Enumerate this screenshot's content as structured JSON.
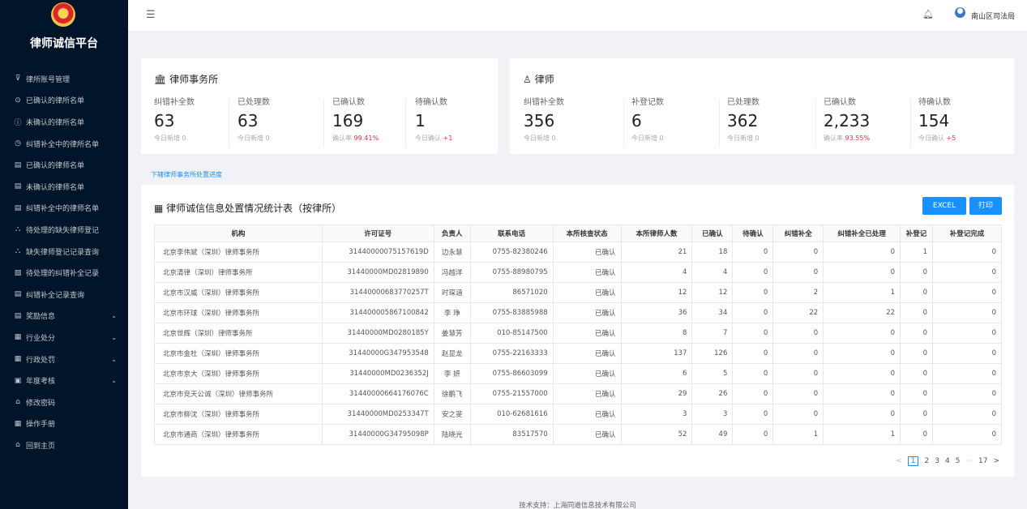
{
  "sidebar": {
    "title": "律师诚信平台",
    "items": [
      {
        "icon": "⊽",
        "label": "律所账号管理",
        "arrow": ""
      },
      {
        "icon": "⊙",
        "label": "已确认的律所名单",
        "arrow": ""
      },
      {
        "icon": "ⓘ",
        "label": "未确认的律所名单",
        "arrow": ""
      },
      {
        "icon": "◷",
        "label": "纠错补全中的律所名单",
        "arrow": ""
      },
      {
        "icon": "▤",
        "label": "已确认的律师名单",
        "arrow": ""
      },
      {
        "icon": "▤",
        "label": "未确认的律师名单",
        "arrow": ""
      },
      {
        "icon": "▤",
        "label": "纠错补全中的律师名单",
        "arrow": ""
      },
      {
        "icon": "⛬",
        "label": "待处理的缺失律师登记",
        "arrow": ""
      },
      {
        "icon": "⛬",
        "label": "缺失律师登记记录查询",
        "arrow": ""
      },
      {
        "icon": "▧",
        "label": "待处理的纠错补全记录",
        "arrow": ""
      },
      {
        "icon": "▤",
        "label": "纠错补全记录查询",
        "arrow": ""
      },
      {
        "icon": "▤",
        "label": "奖励信息",
        "arrow": "⌄"
      },
      {
        "icon": "▦",
        "label": "行业处分",
        "arrow": "⌄"
      },
      {
        "icon": "▦",
        "label": "行政处罚",
        "arrow": "⌄"
      },
      {
        "icon": "▣",
        "label": "年度考核",
        "arrow": "⌄"
      },
      {
        "icon": "⌂",
        "label": "修改密码",
        "arrow": ""
      },
      {
        "icon": "▦",
        "label": "操作手册",
        "arrow": ""
      },
      {
        "icon": "⌂",
        "label": "回到主页",
        "arrow": ""
      }
    ]
  },
  "header": {
    "user": "南山区司法局"
  },
  "firm_card": {
    "title": "律师事务所",
    "stats": [
      {
        "label": "纠错补全数",
        "value": "63",
        "sub": "今日新增 0",
        "sub_hl": ""
      },
      {
        "label": "已处理数",
        "value": "63",
        "sub": "今日新增 0",
        "sub_hl": ""
      },
      {
        "label": "已确认数",
        "value": "169",
        "sub": "确认率 ",
        "sub_hl": "99.41%"
      },
      {
        "label": "待确认数",
        "value": "1",
        "sub": "今日确认 ",
        "sub_hl": "+1"
      }
    ]
  },
  "lawyer_card": {
    "title": "律师",
    "stats": [
      {
        "label": "纠错补全数",
        "value": "356",
        "sub": "今日新增 0",
        "sub_hl": ""
      },
      {
        "label": "补登记数",
        "value": "6",
        "sub": "今日新增 0",
        "sub_hl": ""
      },
      {
        "label": "已处理数",
        "value": "362",
        "sub": "今日新增 0",
        "sub_hl": ""
      },
      {
        "label": "已确认数",
        "value": "2,233",
        "sub": "确认率 ",
        "sub_hl": "93.55%"
      },
      {
        "label": "待确认数",
        "value": "154",
        "sub": "今日确认 ",
        "sub_hl": "+5"
      }
    ]
  },
  "progress_link": "下辖律师事务所处置进度",
  "table_panel": {
    "title": "律师诚信信息处置情况统计表（按律所）",
    "excel_label": "EXCEL",
    "print_label": "打印",
    "columns": [
      "机构",
      "许可证号",
      "负责人",
      "联系电话",
      "本所核查状态",
      "本所律师人数",
      "已确认",
      "待确认",
      "纠错补全",
      "纠错补全已处理",
      "补登记",
      "补登记完成"
    ],
    "rows": [
      [
        "北京李伟斌（深圳）律师事务所",
        "31440000075157619D",
        "边永慧",
        "0755-82380246",
        "已确认",
        "21",
        "18",
        "0",
        "0",
        "0",
        "1",
        "0"
      ],
      [
        "北京清律（深圳）律师事务所",
        "31440000MD02819890",
        "冯越洋",
        "0755-88980795",
        "已确认",
        "4",
        "4",
        "0",
        "0",
        "0",
        "0",
        "0"
      ],
      [
        "北京市汉威（深圳）律师事务所",
        "31440000683770257T",
        "时琛涵",
        "86571020",
        "已确认",
        "12",
        "12",
        "0",
        "2",
        "1",
        "0",
        "0"
      ],
      [
        "北京市环球（深圳）律师事务所",
        "314400005867100842",
        "李 琤",
        "0755-83885988",
        "已确认",
        "36",
        "34",
        "0",
        "22",
        "22",
        "0",
        "0"
      ],
      [
        "北京世辉（深圳）律师事务所",
        "31440000MD0280185Y",
        "姜慧芳",
        "010-85147500",
        "已确认",
        "8",
        "7",
        "0",
        "0",
        "0",
        "0",
        "0"
      ],
      [
        "北京市金杜（深圳）律师事务所",
        "31440000G347953548",
        "赵显龙",
        "0755-22163333",
        "已确认",
        "137",
        "126",
        "0",
        "0",
        "0",
        "0",
        "0"
      ],
      [
        "北京市京大（深圳）律师事务所",
        "31440000MD0236352J",
        "李 妍",
        "0755-86603099",
        "已确认",
        "6",
        "5",
        "0",
        "0",
        "0",
        "0",
        "0"
      ],
      [
        "北京市竞天公诚（深圳）律师事务所",
        "31440000664176076C",
        "徐鹏飞",
        "0755-21557000",
        "已确认",
        "29",
        "26",
        "0",
        "0",
        "0",
        "0",
        "0"
      ],
      [
        "北京市柳沈（深圳）律师事务所",
        "31440000MD0253347T",
        "安之斐",
        "010-62681616",
        "已确认",
        "3",
        "3",
        "0",
        "0",
        "0",
        "0",
        "0"
      ],
      [
        "北京市通商（深圳）律师事务所",
        "31440000G34795098P",
        "陆晓光",
        "83517570",
        "已确认",
        "52",
        "49",
        "0",
        "1",
        "1",
        "0",
        "0"
      ]
    ]
  },
  "pagination": {
    "prev": "<",
    "pages": [
      "1",
      "2",
      "3",
      "4",
      "5"
    ],
    "current": "1",
    "ellipsis": "···",
    "last": "17",
    "next": ">"
  },
  "footer": "技术支持：上海同道信息技术有限公司"
}
